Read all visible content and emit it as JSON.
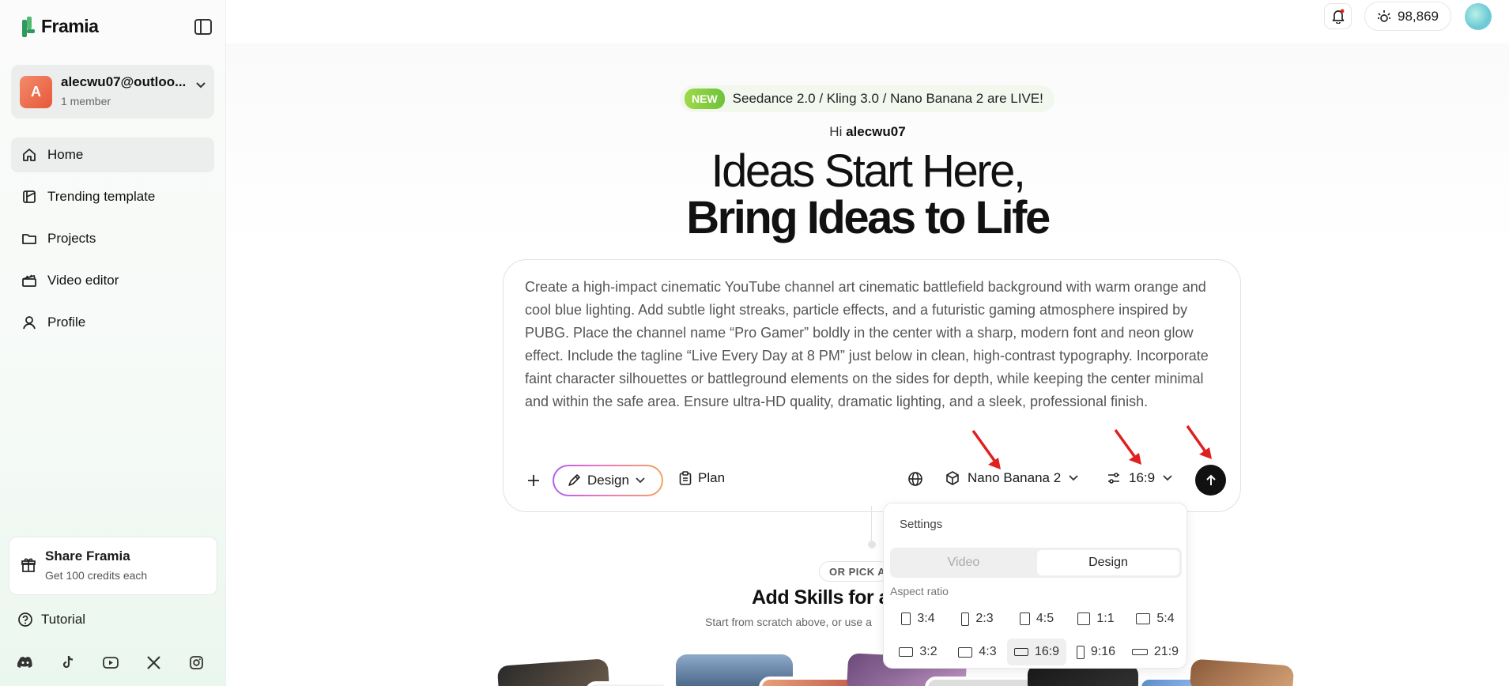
{
  "app": {
    "name": "Framia"
  },
  "account": {
    "initial": "A",
    "name": "alecwu07@outloo...",
    "members": "1 member"
  },
  "nav": [
    {
      "label": "Home",
      "icon": "home-icon",
      "active": true
    },
    {
      "label": "Trending template",
      "icon": "template-icon",
      "active": false
    },
    {
      "label": "Projects",
      "icon": "folder-icon",
      "active": false
    },
    {
      "label": "Video editor",
      "icon": "clapperboard-icon",
      "active": false
    },
    {
      "label": "Profile",
      "icon": "user-icon",
      "active": false
    }
  ],
  "share": {
    "title": "Share Framia",
    "subtitle": "Get 100 credits each"
  },
  "tutorial": {
    "label": "Tutorial"
  },
  "socials": [
    "discord-icon",
    "tiktok-icon",
    "youtube-icon",
    "x-icon",
    "instagram-icon"
  ],
  "header": {
    "credits": "98,869"
  },
  "banner": {
    "badge": "NEW",
    "text": "Seedance 2.0 / Kling 3.0 / Nano Banana 2 are LIVE!"
  },
  "greeting": {
    "hi": "Hi",
    "name": "alecwu07"
  },
  "hero": {
    "line1": "Ideas Start Here,",
    "line2": "Bring Ideas to Life"
  },
  "prompt": {
    "text": "Create a high-impact cinematic YouTube channel art cinematic battlefield background with warm orange and cool blue lighting. Add subtle light streaks, particle effects, and a futuristic gaming atmosphere inspired by PUBG. Place the channel name “Pro Gamer” boldly in the center with a sharp, modern font and neon glow effect. Include the tagline “Live Every Day at 8 PM” just below in clean, high-contrast typography. Incorporate faint character silhouettes or battleground elements on the sides for depth, while keeping the center minimal and within the safe area. Ensure ultra-HD quality, dramatic lighting, and a sleek, professional finish."
  },
  "toolbar": {
    "mode": "Design",
    "plan": "Plan",
    "model": "Nano Banana 2",
    "ratio": "16:9"
  },
  "settings": {
    "title": "Settings",
    "tabs": [
      "Video",
      "Design"
    ],
    "active_tab": "Design",
    "aspect_label": "Aspect ratio",
    "ratios_row1": [
      "3:4",
      "2:3",
      "4:5",
      "1:1",
      "5:4"
    ],
    "ratios_row2": [
      "3:2",
      "4:3",
      "16:9",
      "9:16",
      "21:9"
    ],
    "selected_ratio": "16:9"
  },
  "skills": {
    "pick": "OR PICK A",
    "title": "Add Skills for a",
    "subtitle": "Start from scratch above, or use a"
  },
  "colors": {
    "accent": "#111111",
    "annotation_arrow": "#e02020",
    "new_badge": "#7cc93e"
  }
}
